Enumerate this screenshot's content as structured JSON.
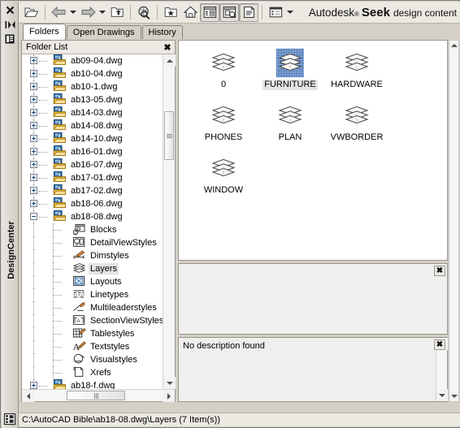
{
  "window": {
    "title": "DesignCenter",
    "close_label": "✖",
    "autohide_icon": "autohide-icon",
    "properties_icon": "properties-icon",
    "bottom_icon": "designcenter-icon"
  },
  "toolbar": {
    "buttons": [
      {
        "name": "load-button",
        "icon": "open-folder-icon",
        "pressed": false
      },
      {
        "name": "back-button",
        "icon": "back-arrow-icon",
        "pressed": false,
        "dropdown": true
      },
      {
        "name": "forward-button",
        "icon": "forward-arrow-icon",
        "pressed": false,
        "dropdown": true
      },
      {
        "name": "up-button",
        "icon": "up-folder-icon",
        "pressed": false
      },
      {
        "name": "search-button",
        "icon": "search-icon",
        "pressed": false
      },
      {
        "name": "favorites-button",
        "icon": "favorites-star-icon",
        "pressed": false
      },
      {
        "name": "home-button",
        "icon": "home-icon",
        "pressed": false
      },
      {
        "name": "tree-view-toggle",
        "icon": "tree-view-icon",
        "pressed": true
      },
      {
        "name": "preview-toggle",
        "icon": "preview-icon",
        "pressed": true
      },
      {
        "name": "description-toggle",
        "icon": "description-icon",
        "pressed": true
      },
      {
        "name": "views-button",
        "icon": "views-icon",
        "pressed": false,
        "dropdown": true
      }
    ],
    "brand": {
      "word1": "Autodesk",
      "trademark": "®",
      "word2": "Seek",
      "word3": "design content"
    }
  },
  "tabs": [
    {
      "label": "Folders",
      "active": true
    },
    {
      "label": "Open Drawings",
      "active": false
    },
    {
      "label": "History",
      "active": false
    }
  ],
  "tree": {
    "header": "Folder List",
    "close_label": "✖",
    "nodes": [
      {
        "label": "ab09-04.dwg",
        "depth": 1,
        "expander": "plus",
        "icon": "dwg-file-icon",
        "selected": false
      },
      {
        "label": "ab10-04.dwg",
        "depth": 1,
        "expander": "plus",
        "icon": "dwg-file-icon",
        "selected": false
      },
      {
        "label": "ab10-1.dwg",
        "depth": 1,
        "expander": "plus",
        "icon": "dwg-file-icon",
        "selected": false
      },
      {
        "label": "ab13-05.dwg",
        "depth": 1,
        "expander": "plus",
        "icon": "dwg-file-icon",
        "selected": false
      },
      {
        "label": "ab14-03.dwg",
        "depth": 1,
        "expander": "plus",
        "icon": "dwg-file-icon",
        "selected": false
      },
      {
        "label": "ab14-08.dwg",
        "depth": 1,
        "expander": "plus",
        "icon": "dwg-file-icon",
        "selected": false
      },
      {
        "label": "ab14-10.dwg",
        "depth": 1,
        "expander": "plus",
        "icon": "dwg-file-icon",
        "selected": false
      },
      {
        "label": "ab16-01.dwg",
        "depth": 1,
        "expander": "plus",
        "icon": "dwg-file-icon",
        "selected": false
      },
      {
        "label": "ab16-07.dwg",
        "depth": 1,
        "expander": "plus",
        "icon": "dwg-file-icon",
        "selected": false
      },
      {
        "label": "ab17-01.dwg",
        "depth": 1,
        "expander": "plus",
        "icon": "dwg-file-icon",
        "selected": false
      },
      {
        "label": "ab17-02.dwg",
        "depth": 1,
        "expander": "plus",
        "icon": "dwg-file-icon",
        "selected": false
      },
      {
        "label": "ab18-06.dwg",
        "depth": 1,
        "expander": "plus",
        "icon": "dwg-file-icon",
        "selected": false
      },
      {
        "label": "ab18-08.dwg",
        "depth": 1,
        "expander": "minus",
        "icon": "dwg-file-icon",
        "selected": false
      },
      {
        "label": "Blocks",
        "depth": 2,
        "expander": "none",
        "icon": "blocks-icon",
        "selected": false
      },
      {
        "label": "DetailViewStyles",
        "depth": 2,
        "expander": "none",
        "icon": "detailviewstyle-icon",
        "selected": false
      },
      {
        "label": "Dimstyles",
        "depth": 2,
        "expander": "none",
        "icon": "dimstyle-icon",
        "selected": false
      },
      {
        "label": "Layers",
        "depth": 2,
        "expander": "none",
        "icon": "layers-icon",
        "selected": true
      },
      {
        "label": "Layouts",
        "depth": 2,
        "expander": "none",
        "icon": "layout-icon",
        "selected": false
      },
      {
        "label": "Linetypes",
        "depth": 2,
        "expander": "none",
        "icon": "linetype-icon",
        "selected": false
      },
      {
        "label": "Multileaderstyles",
        "depth": 2,
        "expander": "none",
        "icon": "multileaderstyle-icon",
        "selected": false
      },
      {
        "label": "SectionViewStyles",
        "depth": 2,
        "expander": "none",
        "icon": "sectionviewstyle-icon",
        "selected": false
      },
      {
        "label": "Tablestyles",
        "depth": 2,
        "expander": "none",
        "icon": "tablestyle-icon",
        "selected": false
      },
      {
        "label": "Textstyles",
        "depth": 2,
        "expander": "none",
        "icon": "textstyle-icon",
        "selected": false
      },
      {
        "label": "Visualstyles",
        "depth": 2,
        "expander": "none",
        "icon": "visualstyle-icon",
        "selected": false
      },
      {
        "label": "Xrefs",
        "depth": 2,
        "expander": "none",
        "icon": "xref-icon",
        "selected": false
      },
      {
        "label": "ab18-f.dwg",
        "depth": 1,
        "expander": "plus",
        "icon": "dwg-file-icon",
        "selected": false
      }
    ]
  },
  "content": {
    "items": [
      {
        "label": "0",
        "icon": "layer-icon",
        "selected": false
      },
      {
        "label": "FURNITURE",
        "icon": "layer-icon",
        "selected": true
      },
      {
        "label": "HARDWARE",
        "icon": "layer-icon",
        "selected": false
      },
      {
        "label": "PHONES",
        "icon": "layer-icon",
        "selected": false
      },
      {
        "label": "PLAN",
        "icon": "layer-icon",
        "selected": false
      },
      {
        "label": "VWBORDER",
        "icon": "layer-icon",
        "selected": false
      },
      {
        "label": "WINDOW",
        "icon": "layer-icon",
        "selected": false
      }
    ]
  },
  "preview": {
    "close_label": "✖",
    "content": ""
  },
  "description": {
    "close_label": "✖",
    "text": "No description found"
  },
  "statusbar": {
    "path": "C:\\AutoCAD Bible\\ab18-08.dwg\\Layers (7 Item(s))"
  },
  "colors": {
    "chrome": "#d4d0c8",
    "toolbar": "#ece9e2",
    "panel_bg": "#ffffff",
    "selection": "#e4e4e4",
    "selection_blue": "#3f6fb5",
    "folder_yellow": "#f7c33c",
    "dwg_blue": "#2f6fae"
  }
}
